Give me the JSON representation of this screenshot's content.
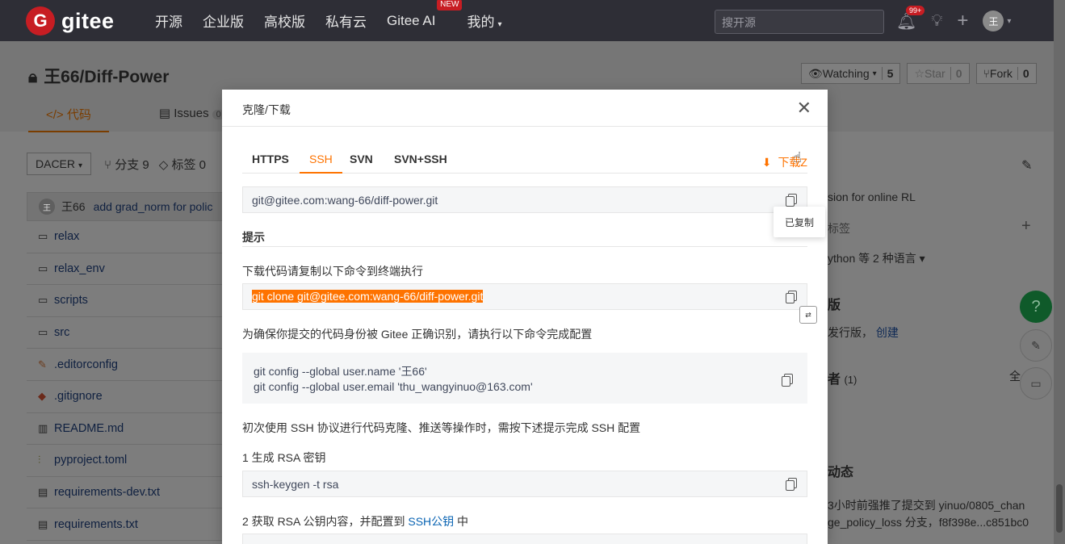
{
  "topbar": {
    "logo_mark": "G",
    "logo_text": "gitee",
    "nav": [
      "开源",
      "企业版",
      "高校版",
      "私有云",
      "Gitee AI",
      "我的"
    ],
    "new_badge": "NEW",
    "search_placeholder": "搜开源",
    "notification_count": "99+",
    "avatar_initial": "王"
  },
  "repo": {
    "title": "王66/Diff-Power",
    "watch_label": "Watching",
    "watch_count": "5",
    "star_label": "Star",
    "star_count": "0",
    "fork_label": "Fork",
    "fork_count": "0",
    "tabs": [
      {
        "label": "代码"
      },
      {
        "label": "Issues",
        "count": "0"
      }
    ],
    "branch_button": "DACER",
    "branches": "分支 9",
    "tags": "标签 0",
    "commit_author_initial": "王",
    "commit_author": "王66",
    "commit_message": "add grad_norm for polic",
    "files": [
      "relax",
      "relax_env",
      "scripts",
      "src",
      ".editorconfig",
      ".gitignore",
      "README.md",
      "pyproject.toml",
      "requirements-dev.txt",
      "requirements.txt"
    ]
  },
  "sidebar": {
    "description": "sion for online RL",
    "tags_label": "标签",
    "languages": "ython 等 2 种语言",
    "release_title": "版",
    "release_text": "发行版，",
    "release_link": "创建",
    "contributors": "者",
    "contributors_count": "(1)",
    "all_label": "全",
    "activity_title": "动态",
    "activity_line1": "3小时前强推了提交到 yinuo/0805_chan",
    "activity_line2": "ge_policy_loss 分支，f8f398e...c851bc0"
  },
  "modal": {
    "title": "克隆/下载",
    "tabs": [
      "HTTPS",
      "SSH",
      "SVN",
      "SVN+SSH"
    ],
    "active_tab": "SSH",
    "download_zip": "下载Z",
    "ssh_url": "git@gitee.com:wang-66/diff-power.git",
    "copied_tooltip": "已复制",
    "tips_title": "提示",
    "tip1": "下载代码请复制以下命令到终端执行",
    "clone_cmd": "git clone git@gitee.com:wang-66/diff-power.git",
    "tip2": "为确保你提交的代码身份被 Gitee 正确识别，请执行以下命令完成配置",
    "config_name": "git config --global user.name '王66'",
    "config_email": "git config --global user.email 'thu_wangyinuo@163.com'",
    "tip3": "初次使用 SSH 协议进行代码克隆、推送等操作时，需按下述提示完成 SSH 配置",
    "step1": "1 生成 RSA 密钥",
    "keygen_cmd": "ssh-keygen -t rsa",
    "step2_prefix": "2 获取 RSA 公钥内容，并配置到 ",
    "step2_link": "SSH公钥",
    "step2_suffix": " 中"
  },
  "colors": {
    "accent": "#fe7300",
    "brand": "#c71d23",
    "link": "#0a64b3"
  }
}
